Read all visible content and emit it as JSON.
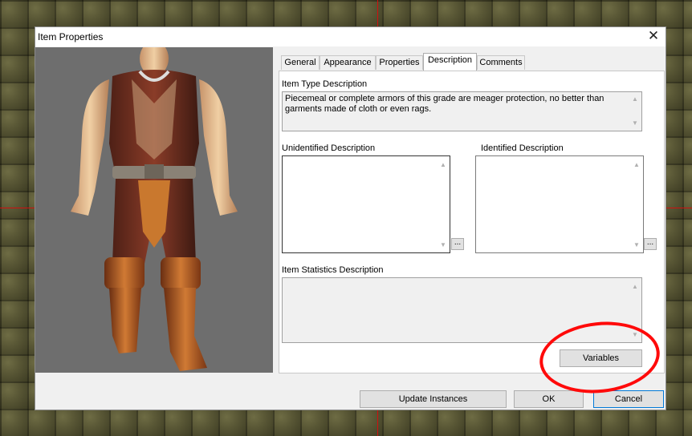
{
  "window": {
    "title": "Item Properties",
    "close_glyph": "✕"
  },
  "tabs": [
    {
      "label": "General"
    },
    {
      "label": "Appearance"
    },
    {
      "label": "Properties"
    },
    {
      "label": "Description",
      "active": true
    },
    {
      "label": "Comments"
    }
  ],
  "description": {
    "item_type_label": "Item Type Description",
    "item_type_text": "Piecemeal or complete armors of this grade are meager protection, no better than garments made of cloth or even rags.",
    "unidentified_label": "Unidentified Description",
    "unidentified_text": "",
    "identified_label": "Identified Description",
    "identified_text": "",
    "statistics_label": "Item Statistics Description",
    "statistics_text": "",
    "ellipsis_label": "...",
    "variables_label": "Variables"
  },
  "footer": {
    "update_label": "Update Instances",
    "ok_label": "OK",
    "cancel_label": "Cancel"
  },
  "icons": {
    "scroll_up": "▲",
    "scroll_down": "▼"
  },
  "colors": {
    "annotation": "#ff0a0a",
    "crosshair": "#d01010",
    "preview_bg": "#6e6e6e"
  }
}
